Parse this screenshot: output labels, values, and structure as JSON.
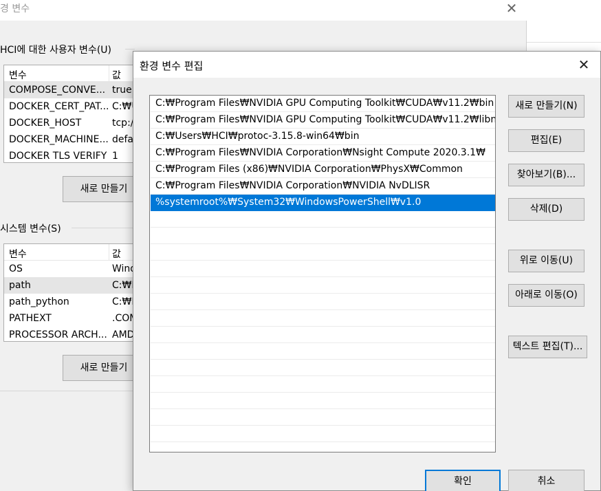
{
  "background_dialog": {
    "title": "경 변수",
    "close_glyph": "✕",
    "user_vars": {
      "label": "HCI에 대한 사용자 변수(U)",
      "col_name": "변수",
      "col_value": "값",
      "rows": [
        {
          "name": "COMPOSE_CONVE...",
          "value": "true"
        },
        {
          "name": "DOCKER_CERT_PAT...",
          "value": "C:₩U"
        },
        {
          "name": "DOCKER_HOST",
          "value": "tcp:/"
        },
        {
          "name": "DOCKER_MACHINE...",
          "value": "defa"
        },
        {
          "name": "DOCKER TLS VERIFY",
          "value": "1"
        }
      ],
      "new_button": "새로 만들기"
    },
    "system_vars": {
      "label": "시스템 변수(S)",
      "col_name": "변수",
      "col_value": "값",
      "rows": [
        {
          "name": "OS",
          "value": "Wind"
        },
        {
          "name": "path",
          "value": "C:₩P"
        },
        {
          "name": "path_python",
          "value": "C:₩P"
        },
        {
          "name": "PATHEXT",
          "value": ".COM"
        },
        {
          "name": "PROCESSOR ARCH...",
          "value": "AMD"
        }
      ],
      "new_button": "새로 만들기"
    }
  },
  "dialog": {
    "title": "환경 변수 편집",
    "close_glyph": "✕",
    "paths": [
      "C:₩Program Files₩NVIDIA GPU Computing Toolkit₩CUDA₩v11.2₩bin",
      "C:₩Program Files₩NVIDIA GPU Computing Toolkit₩CUDA₩v11.2₩libnvvp",
      "C:₩Users₩HCI₩protoc-3.15.8-win64₩bin",
      "C:₩Program Files₩NVIDIA Corporation₩Nsight Compute 2020.3.1₩",
      "C:₩Program Files (x86)₩NVIDIA Corporation₩PhysX₩Common",
      "C:₩Program Files₩NVIDIA Corporation₩NVIDIA NvDLISR",
      "%systemroot%₩System32₩WindowsPowerShell₩v1.0"
    ],
    "selected_index": 6,
    "buttons": {
      "new": "새로 만들기(N)",
      "edit": "편집(E)",
      "browse": "찾아보기(B)...",
      "delete": "삭제(D)",
      "move_up": "위로 이동(U)",
      "move_down": "아래로 이동(O)",
      "edit_text": "텍스트 편집(T)...",
      "ok": "확인",
      "cancel": "취소"
    }
  }
}
